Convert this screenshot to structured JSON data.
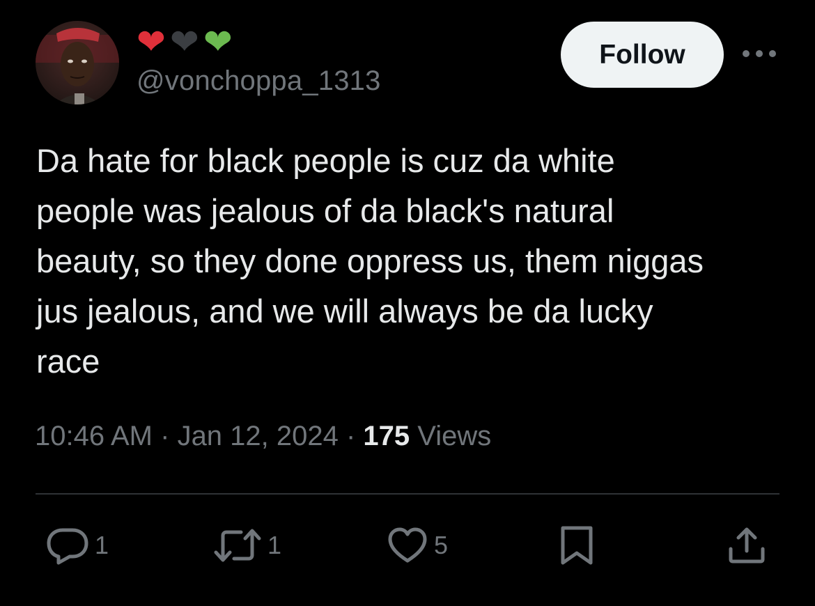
{
  "author": {
    "hearts": [
      "❤",
      "❤",
      "❤"
    ],
    "handle": "@vonchoppa_1313"
  },
  "header": {
    "follow_label": "Follow"
  },
  "tweet": {
    "text": "Da hate for black people is cuz da white\npeople was jealous of da black's natural\nbeauty, so they done oppress us, them niggas\njus jealous, and we will always be da lucky\nrace"
  },
  "meta": {
    "time": "10:46 AM",
    "separator": " · ",
    "date": "Jan 12, 2024",
    "views_count": "175",
    "views_label": " Views"
  },
  "actions": {
    "replies": "1",
    "reposts": "1",
    "likes": "5"
  },
  "colors": {
    "background": "#000000",
    "text": "#e7e9ea",
    "secondary": "#71767b",
    "divider": "#2f3336",
    "follow_bg": "#eff3f4",
    "heart_red": "#e0303a",
    "heart_black": "#3b3e42",
    "heart_green": "#6cba50"
  },
  "icons": [
    "avatar",
    "red-heart-icon",
    "black-heart-icon",
    "green-heart-icon",
    "more-icon",
    "reply-icon",
    "repost-icon",
    "like-icon",
    "bookmark-icon",
    "share-icon"
  ]
}
